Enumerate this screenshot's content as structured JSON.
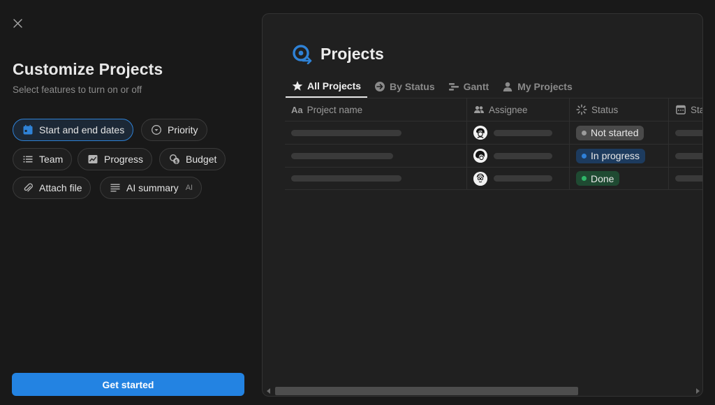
{
  "dialog": {
    "title": "Customize Projects",
    "subtitle": "Select features to turn on or off",
    "features": [
      {
        "label": "Start and end dates",
        "icon": "calendar-icon",
        "selected": true
      },
      {
        "label": "Priority",
        "icon": "chevron-circle-icon",
        "selected": false
      },
      {
        "label": "Team",
        "icon": "list-icon",
        "selected": false
      },
      {
        "label": "Progress",
        "icon": "chart-icon",
        "selected": false
      },
      {
        "label": "Budget",
        "icon": "budget-icon",
        "selected": false
      },
      {
        "label": "Attach file",
        "icon": "paperclip-icon",
        "selected": false
      },
      {
        "label": "AI summary",
        "icon": "text-lines-icon",
        "tag": "AI",
        "selected": false
      }
    ],
    "cta_label": "Get started"
  },
  "preview": {
    "title": "Projects",
    "tabs": [
      {
        "label": "All Projects",
        "icon": "star-icon",
        "active": true
      },
      {
        "label": "By Status",
        "icon": "arrow-circle-icon",
        "active": false
      },
      {
        "label": "Gantt",
        "icon": "gantt-icon",
        "active": false
      },
      {
        "label": "My Projects",
        "icon": "person-icon",
        "active": false
      }
    ],
    "columns": {
      "name_prefix": "Aa",
      "name": "Project name",
      "assignee": "Assignee",
      "status": "Status",
      "start": "Sta"
    },
    "rows": [
      {
        "status": "Not started",
        "status_bg": "#4a4a4a",
        "dot": "#9b9b9b"
      },
      {
        "status": "In progress",
        "status_bg": "#1d3b5e",
        "dot": "#2f80d8"
      },
      {
        "status": "Done",
        "status_bg": "#1f4a32",
        "dot": "#2fb568"
      }
    ]
  },
  "colors": {
    "accent": "#2383e2",
    "background": "#191919",
    "panel": "#202020"
  }
}
